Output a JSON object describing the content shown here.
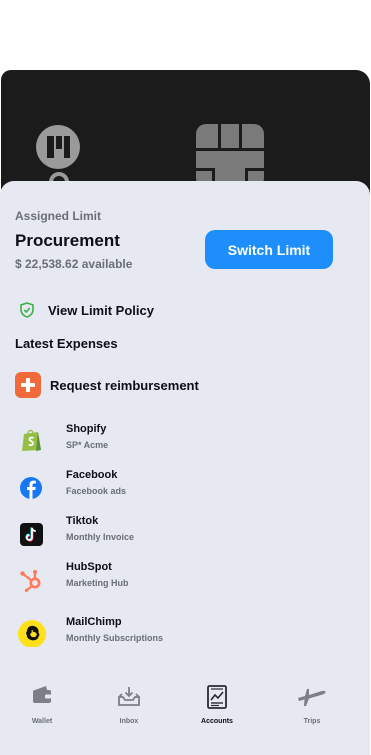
{
  "limit": {
    "assigned_label": "Assigned Limit",
    "name": "Procurement",
    "available": "$ 22,538.62 available",
    "switch_label": "Switch Limit"
  },
  "policy": {
    "label": "View Limit Policy"
  },
  "expenses": {
    "heading": "Latest Expenses",
    "request_label": "Request reimbursement",
    "items": [
      {
        "name": "Shopify",
        "sub": "SP* Acme",
        "icon": "shopify-icon"
      },
      {
        "name": "Facebook",
        "sub": "Facebook ads",
        "icon": "facebook-icon"
      },
      {
        "name": "Tiktok",
        "sub": "Monthly Invoice",
        "icon": "tiktok-icon"
      },
      {
        "name": "HubSpot",
        "sub": "Marketing Hub",
        "icon": "hubspot-icon"
      },
      {
        "name": "MailChimp",
        "sub": "Monthly Subscriptions",
        "icon": "mailchimp-icon"
      }
    ]
  },
  "nav": {
    "items": [
      {
        "label": "Wallet",
        "icon": "wallet-icon"
      },
      {
        "label": "Inbox",
        "icon": "inbox-icon"
      },
      {
        "label": "Accounts",
        "icon": "accounts-icon",
        "active": true
      },
      {
        "label": "Trips",
        "icon": "plane-icon"
      }
    ]
  },
  "colors": {
    "accent": "#1e8ffa",
    "card": "#1b1b1b",
    "sheet": "#e6e9f1",
    "reimburse": "#f06a3b",
    "shopify": "#95bf47",
    "facebook": "#1877f2",
    "hubspot": "#ff7a59",
    "mailchimp": "#ffe01b"
  }
}
